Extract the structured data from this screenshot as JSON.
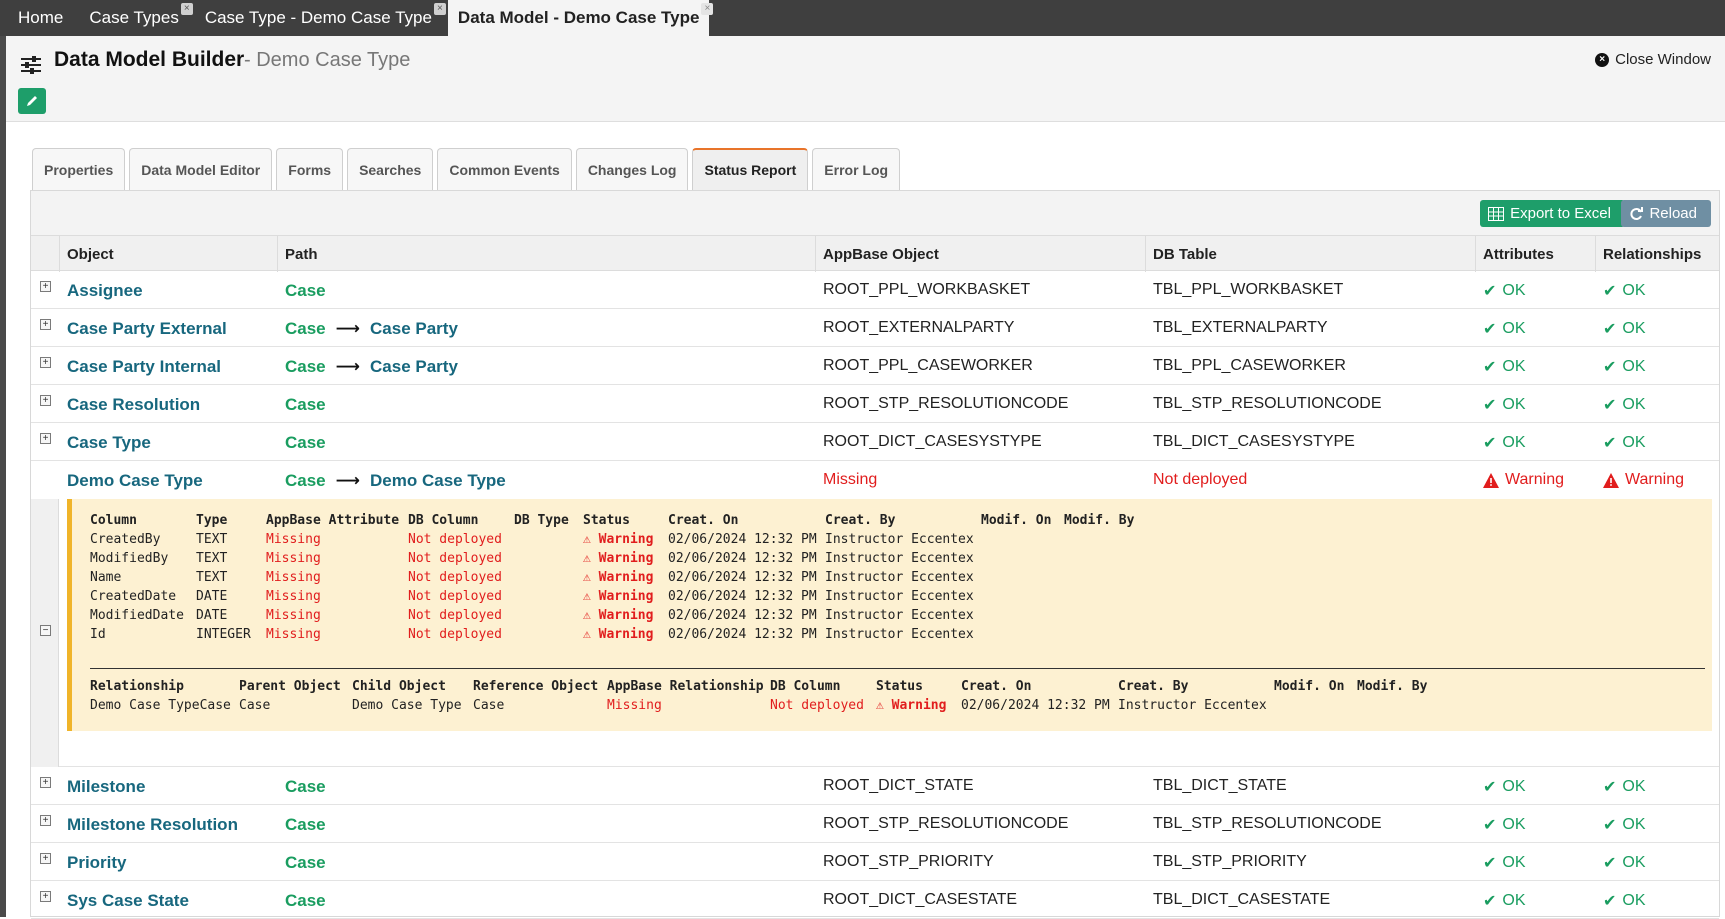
{
  "top_tabs": [
    {
      "label": "Home",
      "active": false,
      "closable": false
    },
    {
      "label": "Case Types",
      "active": false,
      "closable": true
    },
    {
      "label": "Case Type - Demo Case Type",
      "active": false,
      "closable": true
    },
    {
      "label": "Data Model - Demo Case Type",
      "active": true,
      "closable": true
    }
  ],
  "header": {
    "title": "Data Model Builder",
    "subtitle": "- Demo Case Type",
    "close_label": "Close Window"
  },
  "sub_tabs": [
    {
      "label": "Properties",
      "active": false
    },
    {
      "label": "Data Model Editor",
      "active": false
    },
    {
      "label": "Forms",
      "active": false
    },
    {
      "label": "Searches",
      "active": false
    },
    {
      "label": "Common Events",
      "active": false
    },
    {
      "label": "Changes Log",
      "active": false
    },
    {
      "label": "Status Report",
      "active": true
    },
    {
      "label": "Error Log",
      "active": false
    }
  ],
  "toolbar": {
    "export_label": "Export to Excel",
    "reload_label": "Reload"
  },
  "columns": {
    "object": "Object",
    "path": "Path",
    "appbase": "AppBase Object",
    "db_table": "DB Table",
    "attributes": "Attributes",
    "relationships": "Relationships"
  },
  "rows_top": [
    {
      "object": "Assignee",
      "path1": "Case",
      "path2": "",
      "appbase": "ROOT_PPL_WORKBASKET",
      "db": "TBL_PPL_WORKBASKET",
      "attr": "OK",
      "rel": "OK"
    },
    {
      "object": "Case Party External",
      "path1": "Case",
      "path2": "Case Party",
      "appbase": "ROOT_EXTERNALPARTY",
      "db": "TBL_EXTERNALPARTY",
      "attr": "OK",
      "rel": "OK"
    },
    {
      "object": "Case Party Internal",
      "path1": "Case",
      "path2": "Case Party",
      "appbase": "ROOT_PPL_CASEWORKER",
      "db": "TBL_PPL_CASEWORKER",
      "attr": "OK",
      "rel": "OK"
    },
    {
      "object": "Case Resolution",
      "path1": "Case",
      "path2": "",
      "appbase": "ROOT_STP_RESOLUTIONCODE",
      "db": "TBL_STP_RESOLUTIONCODE",
      "attr": "OK",
      "rel": "OK"
    },
    {
      "object": "Case Type",
      "path1": "Case",
      "path2": "",
      "appbase": "ROOT_DICT_CASESYSTYPE",
      "db": "TBL_DICT_CASESYSTYPE",
      "attr": "OK",
      "rel": "OK"
    }
  ],
  "demo_row": {
    "object": "Demo Case Type",
    "path1": "Case",
    "path2": "Demo Case Type",
    "appbase": "Missing",
    "db": "Not deployed",
    "attr": "Warning",
    "rel": "Warning"
  },
  "detail": {
    "attr_headers": [
      "Column",
      "Type",
      "AppBase Attribute",
      "DB Column",
      "DB Type",
      "Status",
      "Creat. On",
      "Creat. By",
      "Modif. On",
      "Modif. By"
    ],
    "attributes": [
      {
        "column": "CreatedBy",
        "type": "TEXT",
        "appbase": "Missing",
        "dbcol": "Not deployed",
        "status": "Warning",
        "creat_on": "02/06/2024 12:32 PM",
        "creat_by": "Instructor Eccentex"
      },
      {
        "column": "ModifiedBy",
        "type": "TEXT",
        "appbase": "Missing",
        "dbcol": "Not deployed",
        "status": "Warning",
        "creat_on": "02/06/2024 12:32 PM",
        "creat_by": "Instructor Eccentex"
      },
      {
        "column": "Name",
        "type": "TEXT",
        "appbase": "Missing",
        "dbcol": "Not deployed",
        "status": "Warning",
        "creat_on": "02/06/2024 12:32 PM",
        "creat_by": "Instructor Eccentex"
      },
      {
        "column": "CreatedDate",
        "type": "DATE",
        "appbase": "Missing",
        "dbcol": "Not deployed",
        "status": "Warning",
        "creat_on": "02/06/2024 12:32 PM",
        "creat_by": "Instructor Eccentex"
      },
      {
        "column": "ModifiedDate",
        "type": "DATE",
        "appbase": "Missing",
        "dbcol": "Not deployed",
        "status": "Warning",
        "creat_on": "02/06/2024 12:32 PM",
        "creat_by": "Instructor Eccentex"
      },
      {
        "column": "Id",
        "type": "INTEGER",
        "appbase": "Missing",
        "dbcol": "Not deployed",
        "status": "Warning",
        "creat_on": "02/06/2024 12:32 PM",
        "creat_by": "Instructor Eccentex"
      }
    ],
    "rel_headers": [
      "Relationship",
      "Parent Object",
      "Child Object",
      "Reference Object",
      "AppBase Relationship",
      "DB Column",
      "Status",
      "Creat. On",
      "Creat. By",
      "Modif. On",
      "Modif. By"
    ],
    "relationship": {
      "name": "Demo Case TypeCase",
      "parent": "Case",
      "child": "Demo Case Type",
      "reference": "Case",
      "appbase": "Missing",
      "dbcol": "Not deployed",
      "status": "Warning",
      "creat_on": "02/06/2024 12:32 PM",
      "creat_by": "Instructor Eccentex"
    }
  },
  "rows_bottom": [
    {
      "object": "Milestone",
      "path1": "Case",
      "path2": "",
      "appbase": "ROOT_DICT_STATE",
      "db": "TBL_DICT_STATE",
      "attr": "OK",
      "rel": "OK"
    },
    {
      "object": "Milestone Resolution",
      "path1": "Case",
      "path2": "",
      "appbase": "ROOT_STP_RESOLUTIONCODE",
      "db": "TBL_STP_RESOLUTIONCODE",
      "attr": "OK",
      "rel": "OK"
    },
    {
      "object": "Priority",
      "path1": "Case",
      "path2": "",
      "appbase": "ROOT_STP_PRIORITY",
      "db": "TBL_STP_PRIORITY",
      "attr": "OK",
      "rel": "OK"
    },
    {
      "object": "Sys Case State",
      "path1": "Case",
      "path2": "",
      "appbase": "ROOT_DICT_CASESTATE",
      "db": "TBL_DICT_CASESTATE",
      "attr": "OK",
      "rel": "OK"
    }
  ],
  "icons": {
    "menu": "sliders-icon",
    "edit": "pencil-icon",
    "close": "close-circle-icon",
    "export": "table-icon",
    "reload": "refresh-icon",
    "ok": "check-icon",
    "warning": "warning-triangle-icon",
    "expand": "plus-square-icon",
    "collapse": "minus-square-icon"
  },
  "colors": {
    "ok": "#1a9d60",
    "error": "#e11d1d",
    "link": "#17677e",
    "accent": "#1e9e6a",
    "detail_bg": "#fdf1d2"
  }
}
